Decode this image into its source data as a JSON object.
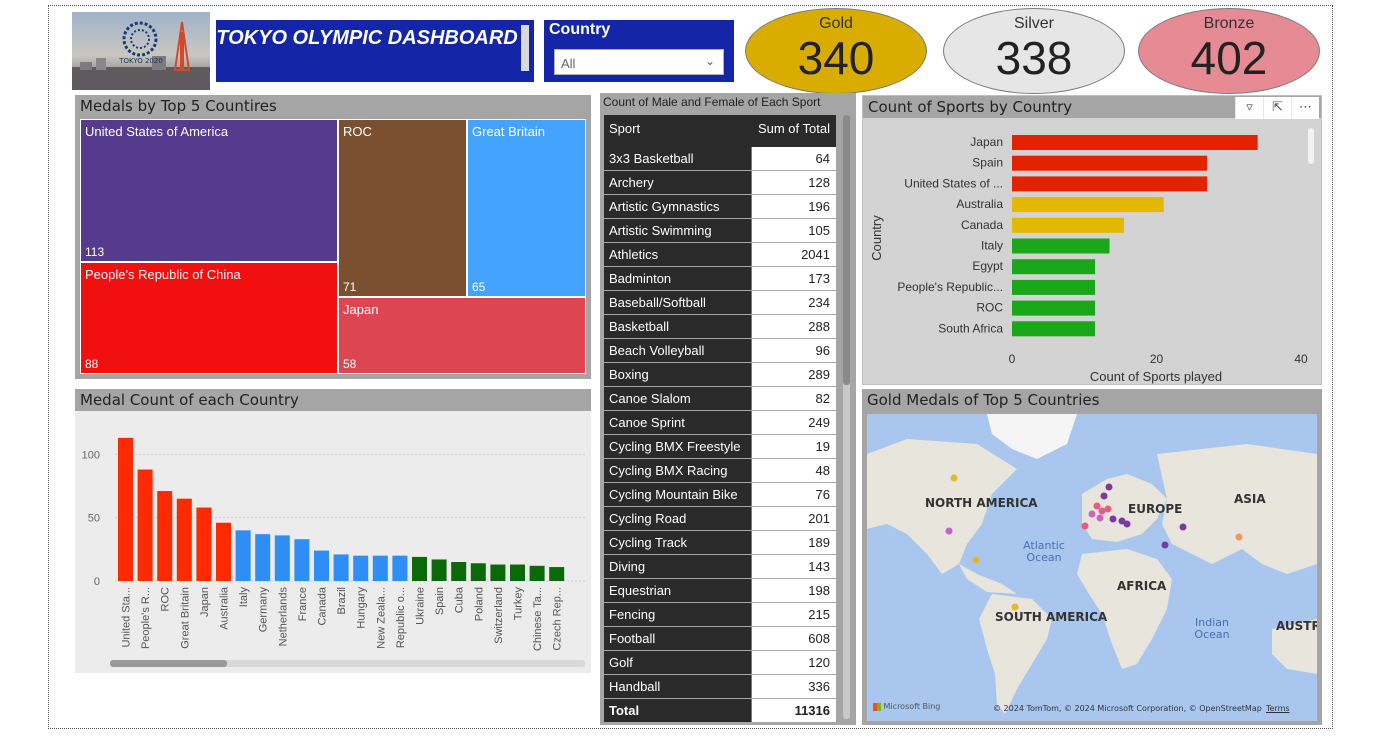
{
  "header": {
    "logo_caption": "TOKYO 2020",
    "title": "TOKYO OLYMPIC DASHBOARD",
    "slicer_label": "Country",
    "slicer_value": "All"
  },
  "kpis": [
    {
      "label": "Gold",
      "value": "340",
      "color": "#d9ad00"
    },
    {
      "label": "Silver",
      "value": "338",
      "color": "#e6e6e6"
    },
    {
      "label": "Bronze",
      "value": "402",
      "color": "#e68a94"
    }
  ],
  "treemap": {
    "title": "Medals by Top 5 Countires",
    "cells": [
      {
        "name": "United States of America",
        "value": "113",
        "color": "#563a8e"
      },
      {
        "name": "People's Republic of China",
        "value": "88",
        "color": "#f20f0f"
      },
      {
        "name": "ROC",
        "value": "71",
        "color": "#7b5030"
      },
      {
        "name": "Great Britain",
        "value": "65",
        "color": "#44a4fd"
      },
      {
        "name": "Japan",
        "value": "58",
        "color": "#db4651"
      }
    ]
  },
  "table": {
    "title": "Count of Male and Female of Each Sport",
    "col1": "Sport",
    "col2": "Sum of Total",
    "rows": [
      {
        "sport": "3x3 Basketball",
        "total": "64"
      },
      {
        "sport": "Archery",
        "total": "128"
      },
      {
        "sport": "Artistic Gymnastics",
        "total": "196"
      },
      {
        "sport": "Artistic Swimming",
        "total": "105"
      },
      {
        "sport": "Athletics",
        "total": "2041"
      },
      {
        "sport": "Badminton",
        "total": "173"
      },
      {
        "sport": "Baseball/Softball",
        "total": "234"
      },
      {
        "sport": "Basketball",
        "total": "288"
      },
      {
        "sport": "Beach Volleyball",
        "total": "96"
      },
      {
        "sport": "Boxing",
        "total": "289"
      },
      {
        "sport": "Canoe Slalom",
        "total": "82"
      },
      {
        "sport": "Canoe Sprint",
        "total": "249"
      },
      {
        "sport": "Cycling BMX Freestyle",
        "total": "19"
      },
      {
        "sport": "Cycling BMX Racing",
        "total": "48"
      },
      {
        "sport": "Cycling Mountain Bike",
        "total": "76"
      },
      {
        "sport": "Cycling Road",
        "total": "201"
      },
      {
        "sport": "Cycling Track",
        "total": "189"
      },
      {
        "sport": "Diving",
        "total": "143"
      },
      {
        "sport": "Equestrian",
        "total": "198"
      },
      {
        "sport": "Fencing",
        "total": "215"
      },
      {
        "sport": "Football",
        "total": "608"
      },
      {
        "sport": "Golf",
        "total": "120"
      },
      {
        "sport": "Handball",
        "total": "336"
      }
    ],
    "total_label": "Total",
    "total_value": "11316"
  },
  "map": {
    "title": "Gold Medals of Top 5 Countries",
    "labels": {
      "na": "NORTH AMERICA",
      "eu": "EUROPE",
      "asia": "ASIA",
      "atl": "Atlantic Ocean",
      "africa": "AFRICA",
      "sa": "SOUTH AMERICA",
      "indian": "Indian Ocean",
      "aus": "AUSTRA"
    },
    "attribution": "© 2024 TomTom, © 2024 Microsoft Corporation, © OpenStreetMap",
    "terms": "Terms",
    "brand": "Microsoft Bing"
  },
  "chart_data": [
    {
      "type": "bar",
      "title": "Medal Count of each Country",
      "categories": [
        "United Sta...",
        "People's R...",
        "ROC",
        "Great Britain",
        "Japan",
        "Australia",
        "Italy",
        "Germany",
        "Netherlands",
        "France",
        "Canada",
        "Brazil",
        "Hungary",
        "New Zeala...",
        "Republic o...",
        "Ukraine",
        "Spain",
        "Cuba",
        "Poland",
        "Switzerland",
        "Turkey",
        "Chinese Ta...",
        "Czech Rep..."
      ],
      "values": [
        113,
        88,
        71,
        65,
        58,
        46,
        40,
        37,
        36,
        33,
        24,
        21,
        20,
        20,
        20,
        19,
        17,
        15,
        14,
        13,
        13,
        12,
        11
      ],
      "colors": [
        "#ff2a00",
        "#ff2a00",
        "#ff2a00",
        "#ff2a00",
        "#ff2a00",
        "#ff2a00",
        "#2f8ef5",
        "#2f8ef5",
        "#2f8ef5",
        "#2f8ef5",
        "#2f8ef5",
        "#2f8ef5",
        "#2f8ef5",
        "#2f8ef5",
        "#2f8ef5",
        "#0a6a0a",
        "#0a6a0a",
        "#0a6a0a",
        "#0a6a0a",
        "#0a6a0a",
        "#0a6a0a",
        "#0a6a0a",
        "#0a6a0a"
      ],
      "yticks": [
        "0",
        "50",
        "100"
      ],
      "ylim": [
        0,
        120
      ],
      "grid": true
    },
    {
      "type": "bar",
      "orientation": "horizontal",
      "title": "Count of Sports by Country",
      "categories": [
        "Japan",
        "Spain",
        "United States of ...",
        "Australia",
        "Canada",
        "Italy",
        "Egypt",
        "People's Republic...",
        "ROC",
        "South Africa"
      ],
      "values": [
        34,
        27,
        27,
        21,
        15.5,
        13.5,
        11.5,
        11.5,
        11.5,
        11.5
      ],
      "colors": [
        "#e52200",
        "#e52200",
        "#e52200",
        "#e3b800",
        "#e3b800",
        "#1aa81a",
        "#1aa81a",
        "#1aa81a",
        "#1aa81a",
        "#1aa81a"
      ],
      "xlabel": "Count of Sports played",
      "ylabel": "Country",
      "xticks": [
        "0",
        "20",
        "40"
      ],
      "xlim": [
        0,
        40
      ]
    }
  ]
}
